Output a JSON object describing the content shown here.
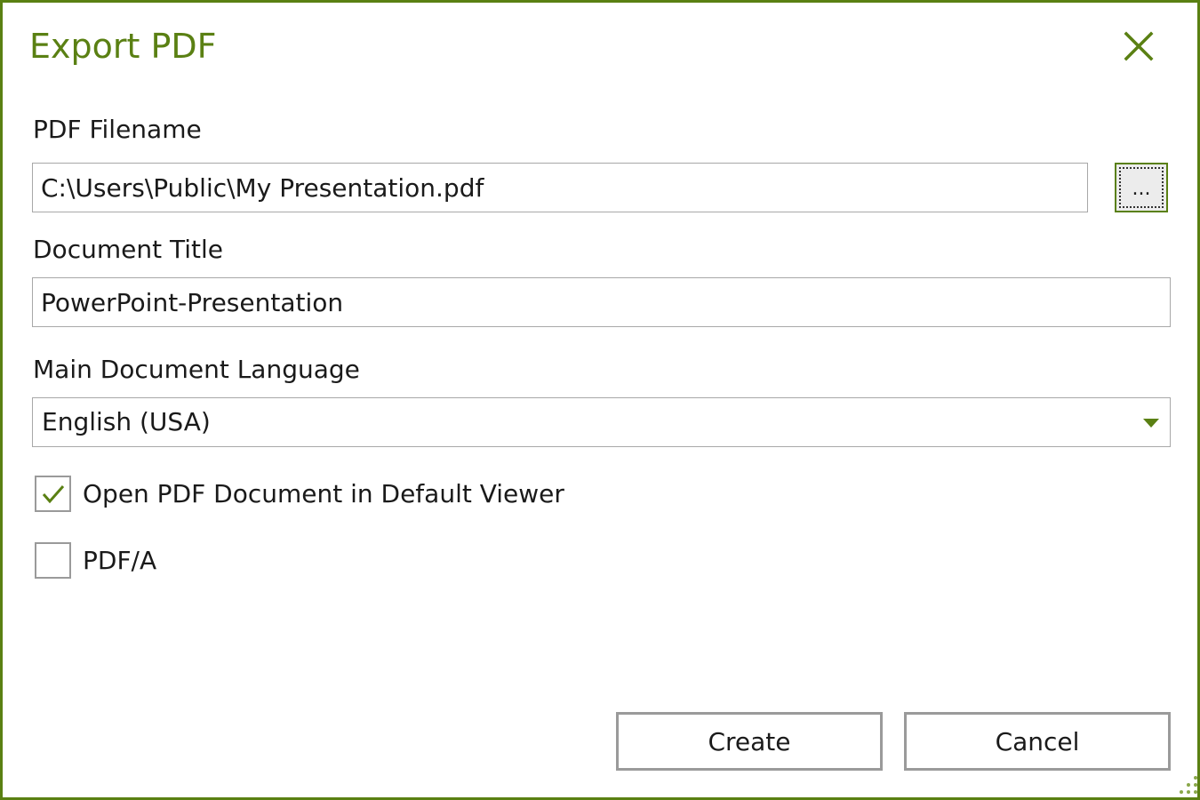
{
  "dialog": {
    "title": "Export PDF",
    "accent_color": "#5a8013",
    "close_icon": "close-icon"
  },
  "filename": {
    "label": "PDF Filename",
    "value": "C:\\Users\\Public\\My Presentation.pdf",
    "browse_label": "..."
  },
  "doc_title": {
    "label": "Document Title",
    "value": "PowerPoint-Presentation"
  },
  "language": {
    "label": "Main Document Language",
    "selected": "English (USA)",
    "arrow_icon": "dropdown-arrow-icon"
  },
  "options": {
    "open_viewer": {
      "label": "Open PDF Document in Default Viewer",
      "checked": true
    },
    "pdfa": {
      "label": "PDF/A",
      "checked": false
    }
  },
  "buttons": {
    "create": "Create",
    "cancel": "Cancel"
  }
}
